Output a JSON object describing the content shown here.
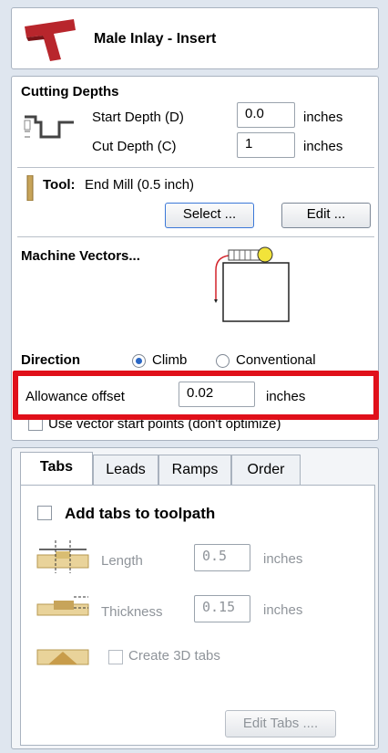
{
  "header": {
    "title": "Male Inlay - Insert",
    "logo_icon": "red-t-logo"
  },
  "cutting_depths": {
    "heading": "Cutting Depths",
    "start_label": "Start Depth (D)",
    "start_value": "0.0",
    "start_unit": "inches",
    "cut_label": "Cut Depth (C)",
    "cut_value": "1",
    "cut_unit": "inches"
  },
  "tool": {
    "label": "Tool:",
    "value": "End Mill (0.5 inch)",
    "select_button": "Select ...",
    "edit_button": "Edit ..."
  },
  "machine_vectors": {
    "heading": "Machine Vectors..."
  },
  "direction": {
    "label": "Direction",
    "climb": "Climb",
    "conventional": "Conventional",
    "selected": "Climb"
  },
  "allowance": {
    "label": "Allowance offset",
    "value": "0.02",
    "unit": "inches",
    "highlight_color": "#e0101a"
  },
  "vector_start": {
    "label": "Use vector start points (don't optimize)"
  },
  "tabs": {
    "items": [
      "Tabs",
      "Leads",
      "Ramps",
      "Order"
    ],
    "active": "Tabs",
    "add_tabs_label": "Add tabs to toolpath",
    "length_label": "Length",
    "length_value": "0.5",
    "length_unit": "inches",
    "thickness_label": "Thickness",
    "thickness_value": "0.15",
    "thickness_unit": "inches",
    "create3d_label": "Create 3D tabs",
    "edit_tabs_button": "Edit Tabs ...."
  },
  "colors": {
    "accent": "#2a67c5",
    "logo": "#b8262c"
  }
}
